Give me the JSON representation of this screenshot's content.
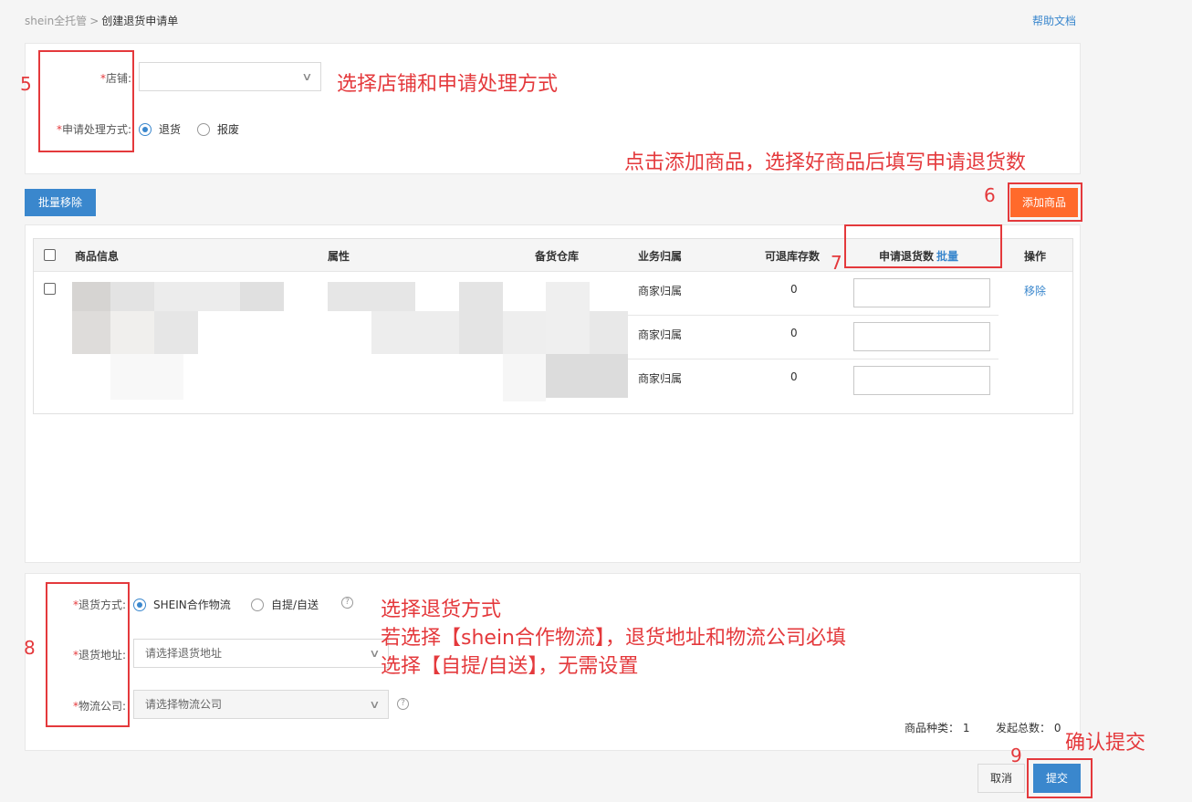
{
  "breadcrumb": {
    "root": "shein全托管",
    "separator": ">",
    "current": "创建退货申请单"
  },
  "help_link": "帮助文档",
  "form_top": {
    "shop_label": "店铺",
    "shop_value": "",
    "method_label": "申请处理方式",
    "method_options": [
      "退货",
      "报废"
    ],
    "method_selected": "退货"
  },
  "actions": {
    "batch_remove": "批量移除",
    "add_product": "添加商品"
  },
  "table": {
    "headers": [
      "商品信息",
      "属性",
      "备货仓库",
      "业务归属",
      "可退库存数",
      "申请退货数",
      "批量",
      "操作"
    ],
    "rows": [
      {
        "ownership": "商家归属",
        "stock": "0",
        "qty": ""
      },
      {
        "ownership": "商家归属",
        "stock": "0",
        "qty": ""
      },
      {
        "ownership": "商家归属",
        "stock": "0",
        "qty": ""
      }
    ],
    "remove_label": "移除"
  },
  "form_bottom": {
    "return_method_label": "退货方式",
    "return_method_options": [
      "SHEIN合作物流",
      "自提/自送"
    ],
    "return_method_selected": "SHEIN合作物流",
    "address_label": "退货地址",
    "address_placeholder": "请选择退货地址",
    "logistics_label": "物流公司",
    "logistics_placeholder": "请选择物流公司"
  },
  "summary": {
    "kinds_label": "商品种类：",
    "kinds_value": "1",
    "total_label": "发起总数：",
    "total_value": "0"
  },
  "footer": {
    "cancel": "取消",
    "submit": "提交"
  },
  "annotations": {
    "n5": "5",
    "t5": "选择店铺和申请处理方式",
    "t6": "点击添加商品，选择好商品后填写申请退货数",
    "n6": "6",
    "n7": "7",
    "n8": "8",
    "t8_1": "选择退货方式",
    "t8_2": "若选择【shein合作物流】，退货地址和物流公司必填",
    "t8_3": "选择【自提/自送】，无需设置",
    "n9": "9",
    "t9": "确认提交"
  },
  "colors": {
    "primary": "#3a87cd",
    "orange": "#ff6a2b",
    "annotation_red": "#e4393c"
  }
}
